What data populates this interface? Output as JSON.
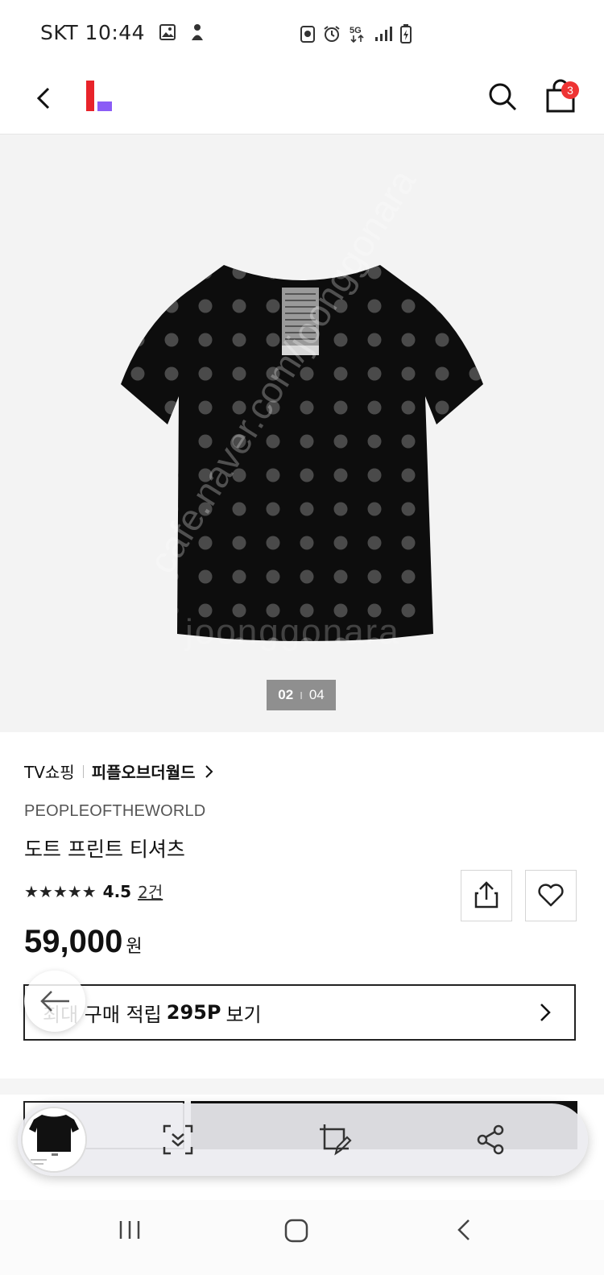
{
  "status": {
    "carrier_time": "SKT 10:44"
  },
  "header": {
    "cart_count": "3",
    "logo_colors": [
      "#e8232a",
      "#8b5cf6"
    ]
  },
  "gallery": {
    "current": "02",
    "separator": "I",
    "total": "04",
    "watermark_1": "cafe.naver.com/joonggonara",
    "watermark_2": "joonggonara"
  },
  "product": {
    "category": "TV쇼핑",
    "brand_link": "피플오브더월드",
    "brand_en": "PEOPLEOFTHEWORLD",
    "name": "도트 프린트 티셔츠",
    "stars": "★★★★★",
    "rating": "4.5",
    "review_count": "2건",
    "price": "59,000",
    "currency": "원"
  },
  "points": {
    "prefix": "최대 구매 적립",
    "amount": "295P",
    "suffix": "보기"
  },
  "capture_bar": {
    "icons": [
      "scroll-capture-icon",
      "edit-capture-icon",
      "share-icon"
    ]
  },
  "navbar": {
    "icons": [
      "recent-apps-icon",
      "home-icon",
      "back-icon"
    ]
  }
}
